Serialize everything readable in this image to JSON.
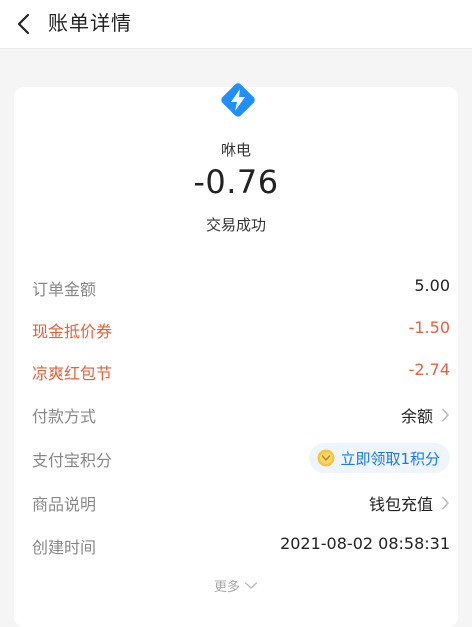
{
  "header": {
    "title": "账单详情"
  },
  "merchant": {
    "name": "咻电",
    "amount": "-0.76",
    "status": "交易成功"
  },
  "details": [
    {
      "label": "订单金额",
      "value": "5.00"
    },
    {
      "label": "现金抵价券",
      "value": "-1.50"
    },
    {
      "label": "凉爽红包节",
      "value": "-2.74"
    },
    {
      "label": "付款方式",
      "value": "余额"
    },
    {
      "label": "支付宝积分",
      "value": "立即领取1积分"
    },
    {
      "label": "商品说明",
      "value": "钱包充值"
    },
    {
      "label": "创建时间",
      "value": "2021-08-02 08:58:31"
    }
  ],
  "more_label": "更多",
  "colors": {
    "discount": "#e8613c",
    "accent": "#1677ff",
    "logo": "#1e90ff"
  }
}
